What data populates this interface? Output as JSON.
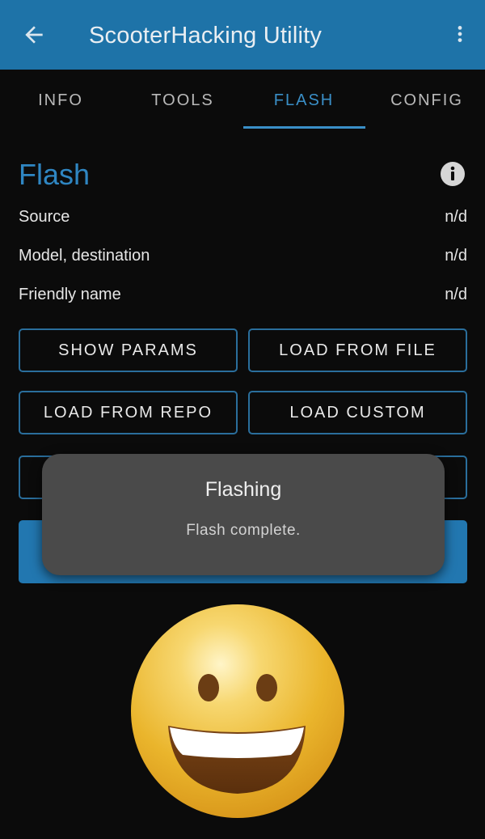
{
  "app": {
    "title": "ScooterHacking Utility",
    "back_icon": "arrow-left-icon",
    "more_icon": "more-vert-icon"
  },
  "tabs": [
    {
      "label": "INFO",
      "active": false
    },
    {
      "label": "TOOLS",
      "active": false
    },
    {
      "label": "FLASH",
      "active": true
    },
    {
      "label": "CONFIG",
      "active": false
    }
  ],
  "section": {
    "title": "Flash",
    "info_icon": "info-icon"
  },
  "details": [
    {
      "label": "Source",
      "value": "n/d"
    },
    {
      "label": "Model, destination",
      "value": "n/d"
    },
    {
      "label": "Friendly name",
      "value": "n/d"
    }
  ],
  "buttons": {
    "show_params": "SHOW PARAMS",
    "load_from_file": "LOAD FROM FILE",
    "load_from_repo": "LOAD FROM REPO",
    "load_custom": "LOAD CUSTOM"
  },
  "toast": {
    "title": "Flashing",
    "message": "Flash complete."
  },
  "emoji": "grinning-face-icon",
  "colors": {
    "appbar": "#1e73a8",
    "accent": "#3a8fc7",
    "button_border": "#2a6e9c",
    "toast_bg": "#4a4a4a",
    "background": "#0b0b0b"
  }
}
